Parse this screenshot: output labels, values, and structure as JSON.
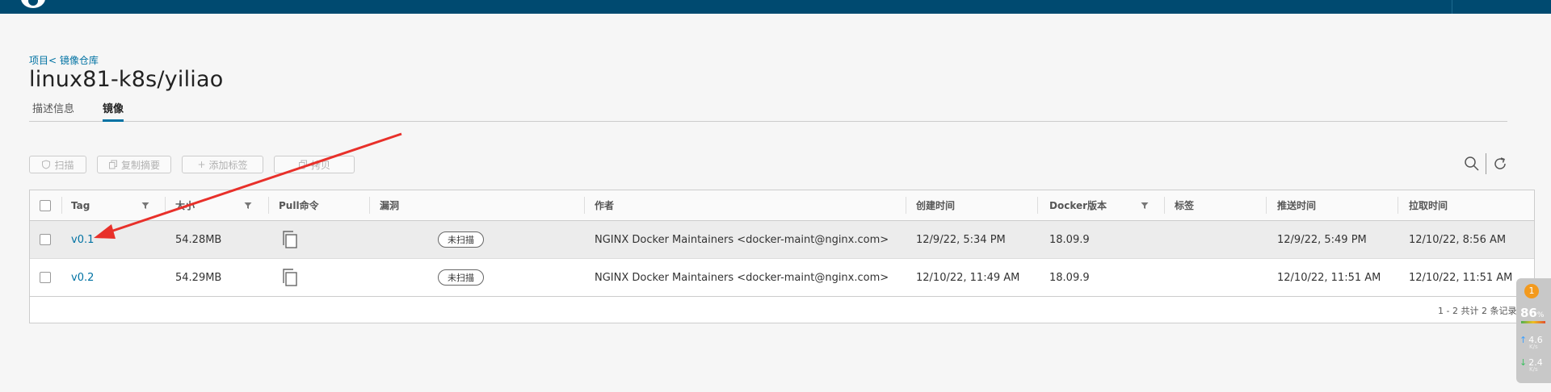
{
  "header": {
    "bg_color": "#004a70"
  },
  "breadcrumb": "项目< 镜像仓库",
  "page_title": "linux81-k8s/yiliao",
  "tabs": [
    {
      "label": "描述信息",
      "active": false
    },
    {
      "label": "镜像",
      "active": true
    }
  ],
  "toolbar": {
    "buttons": [
      {
        "label": "扫描",
        "icon": "shield-icon"
      },
      {
        "label": "复制摘要",
        "icon": "copy-icon"
      },
      {
        "label": "添加标签",
        "icon": "plus-icon"
      },
      {
        "label": "拷贝",
        "icon": "copy-icon"
      }
    ]
  },
  "table": {
    "columns": [
      "Tag",
      "大小",
      "Pull命令",
      "漏洞",
      "作者",
      "创建时间",
      "Docker版本",
      "标签",
      "推送时间",
      "拉取时间"
    ],
    "rows": [
      {
        "tag": "v0.1",
        "size": "54.28MB",
        "vuln": "未扫描",
        "author": "NGINX Docker Maintainers <docker-maint@nginx.com>",
        "created": "12/9/22, 5:34 PM",
        "docker": "18.09.9",
        "labels": "",
        "pushed": "12/9/22, 5:49 PM",
        "pulled": "12/10/22, 8:56 AM"
      },
      {
        "tag": "v0.2",
        "size": "54.29MB",
        "vuln": "未扫描",
        "author": "NGINX Docker Maintainers <docker-maint@nginx.com>",
        "created": "12/10/22, 11:49 AM",
        "docker": "18.09.9",
        "labels": "",
        "pushed": "12/10/22, 11:51 AM",
        "pulled": "12/10/22, 11:51 AM"
      }
    ],
    "footer": "1 - 2 共计 2 条记录"
  },
  "widget": {
    "badge": "1",
    "percent": "86",
    "percent_unit": "%",
    "up": "4.6",
    "down": "2.4",
    "rate_unit": "K/s"
  },
  "colors": {
    "accent": "#0072a3",
    "annotation_arrow": "#e8302a"
  }
}
